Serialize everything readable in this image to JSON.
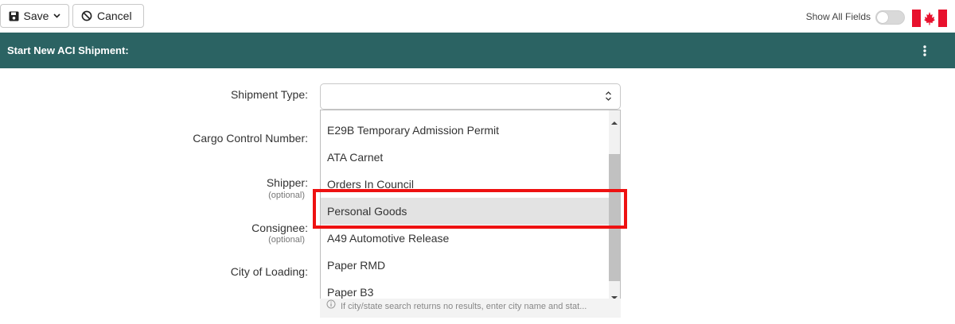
{
  "toolbar": {
    "save_label": "Save",
    "cancel_label": "Cancel",
    "show_all_fields_label": "Show All Fields",
    "show_all_fields_on": false
  },
  "header": {
    "title": "Start New ACI Shipment:"
  },
  "form": {
    "fields": [
      {
        "label": "Shipment Type:"
      },
      {
        "label": "Cargo Control Number:"
      },
      {
        "label": "Shipper:",
        "sub": "(optional)"
      },
      {
        "label": "Consignee:",
        "sub": "(optional)"
      },
      {
        "label": "City of Loading:"
      }
    ],
    "shipment_type_value": "",
    "dropdown_options": [
      "E29B Temporary Admission Permit",
      "ATA Carnet",
      "Orders In Council",
      "Personal Goods",
      "A49 Automotive Release",
      "Paper RMD",
      "Paper B3"
    ],
    "highlighted_option": "Personal Goods",
    "city_hint": "If city/state search returns no results, enter city name and stat..."
  },
  "colors": {
    "header_bg": "#2b6363",
    "highlight_border": "#ee1111",
    "flag_red": "#e8112d"
  }
}
